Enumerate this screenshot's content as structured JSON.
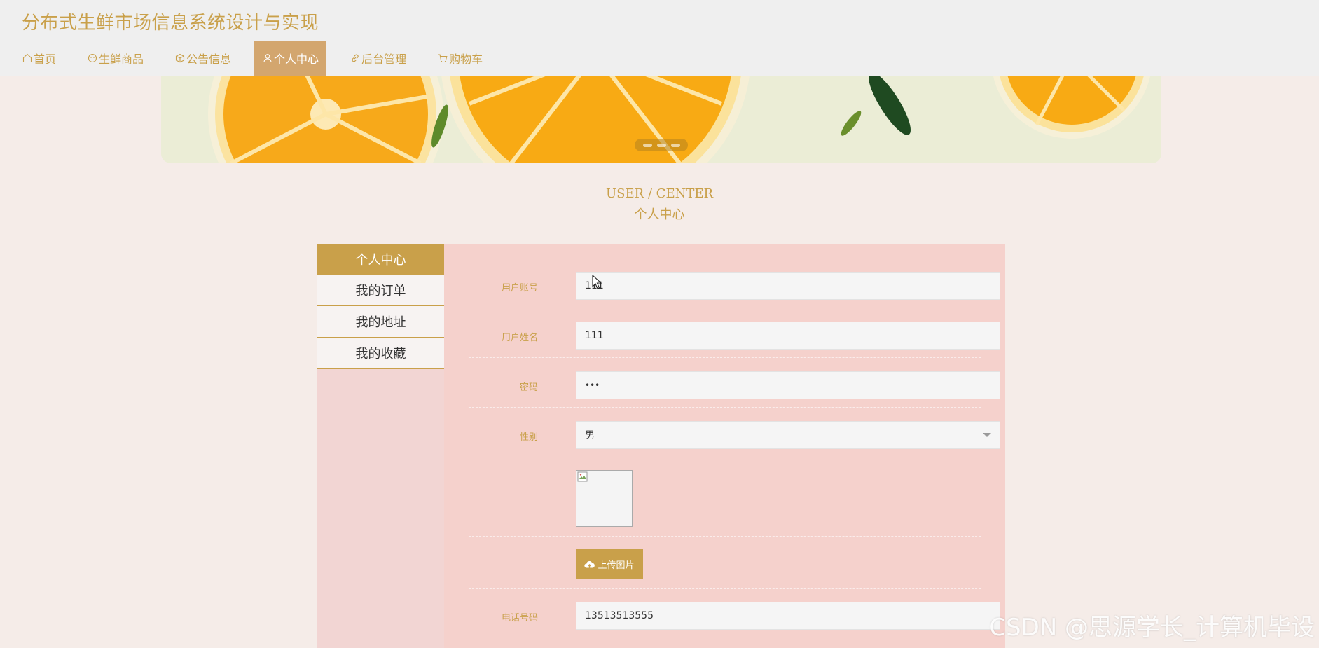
{
  "app": {
    "title": "分布式生鲜市场信息系统设计与实现"
  },
  "nav": [
    {
      "label": "首页",
      "icon": "home-icon"
    },
    {
      "label": "生鲜商品",
      "icon": "smile-icon"
    },
    {
      "label": "公告信息",
      "icon": "box-icon"
    },
    {
      "label": "个人中心",
      "icon": "user-icon",
      "active": true
    },
    {
      "label": "后台管理",
      "icon": "link-icon"
    },
    {
      "label": "购物车",
      "icon": "cart-icon"
    }
  ],
  "section": {
    "title_en": "USER / CENTER",
    "title_cn": "个人中心"
  },
  "sidebar": {
    "header": "个人中心",
    "items": [
      {
        "label": "我的订单"
      },
      {
        "label": "我的地址"
      },
      {
        "label": "我的收藏"
      }
    ]
  },
  "form": {
    "account": {
      "label": "用户账号",
      "value": "111"
    },
    "name": {
      "label": "用户姓名",
      "value": "111"
    },
    "password": {
      "label": "密码",
      "value": "•••"
    },
    "gender": {
      "label": "性别",
      "value": "男"
    },
    "upload": {
      "label": "上传图片",
      "icon": "cloud-upload-icon"
    },
    "phone": {
      "label": "电话号码",
      "value": "13513513555"
    }
  },
  "watermark": "CSDN @思源学长_计算机毕设",
  "colors": {
    "accent": "#c9a04a",
    "nav_active": "#d3a66e",
    "panel": "#f5d1cc",
    "background": "#f5ece8"
  }
}
